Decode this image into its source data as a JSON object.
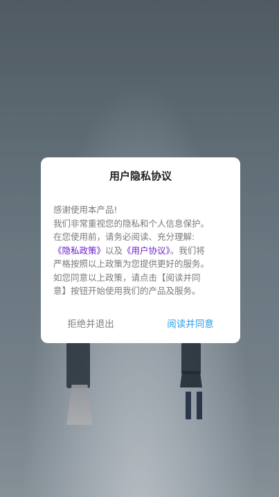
{
  "dialog": {
    "title": "用户隐私协议",
    "greeting": "感谢使用本产品!",
    "line1": "我们非常重视您的隐私和个人信息保护。",
    "line2": "在您使用前，请务必阅读、充分理解:",
    "privacy_link": "《隐私政策》",
    "connector": "以及",
    "agreement_link": "《用户协议》",
    "line3_tail": "。我们将",
    "line4": "严格按照以上政策为您提供更好的服务。",
    "line5": "如您同意以上政策，请点击【阅读并同",
    "line6": "意】按钮开始使用我们的产品及服务。",
    "reject_label": "拒绝并退出",
    "agree_label": "阅读并同意"
  },
  "colors": {
    "link": "#6a1fc8",
    "agree": "#2f9ee8",
    "reject": "#808080"
  }
}
